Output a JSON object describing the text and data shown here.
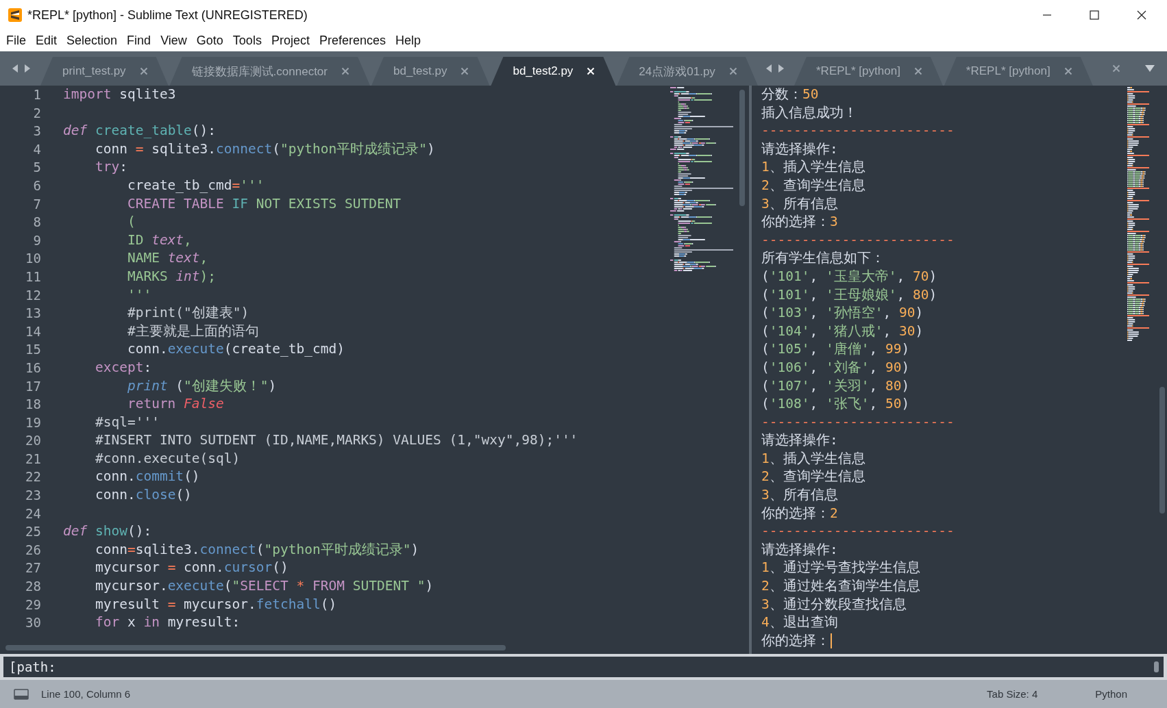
{
  "window": {
    "title": "*REPL* [python] - Sublime Text (UNREGISTERED)"
  },
  "menu": [
    "File",
    "Edit",
    "Selection",
    "Find",
    "View",
    "Goto",
    "Tools",
    "Project",
    "Preferences",
    "Help"
  ],
  "left_tabs": [
    {
      "label": "print_test.py",
      "selected": false
    },
    {
      "label": "链接数据库测试.connector",
      "selected": false
    },
    {
      "label": "bd_test.py",
      "selected": false
    },
    {
      "label": "bd_test2.py",
      "selected": true
    },
    {
      "label": "24点游戏01.py",
      "selected": false
    }
  ],
  "right_tabs": [
    {
      "label": "*REPL* [python]",
      "selected": false
    },
    {
      "label": "*REPL* [python]",
      "selected": false
    }
  ],
  "editor": {
    "lines": [
      {
        "number": "1",
        "tokens": [
          {
            "kind": "keyword",
            "text": "import"
          },
          {
            "kind": "plain",
            "text": " sqlite3"
          }
        ]
      },
      {
        "number": "2"
      },
      {
        "number": "3",
        "tokens": [
          {
            "kind": "storage",
            "text": "def"
          },
          {
            "kind": "entity",
            "text": " create_table"
          },
          {
            "kind": "plain",
            "text": "():"
          }
        ]
      },
      {
        "number": "4",
        "tokens": [
          {
            "kind": "plain",
            "text": "    conn "
          },
          {
            "kind": "operator",
            "text": "="
          },
          {
            "kind": "plain",
            "text": " sqlite3."
          },
          {
            "kind": "method",
            "text": "connect"
          },
          {
            "kind": "plain",
            "text": "("
          },
          {
            "kind": "string",
            "text": "\"python平时成绩记录\""
          },
          {
            "kind": "plain",
            "text": ")"
          }
        ]
      },
      {
        "number": "5",
        "tokens": [
          {
            "kind": "keyword",
            "text": "    try"
          },
          {
            "kind": "plain",
            "text": ":"
          }
        ]
      },
      {
        "number": "6",
        "tokens": [
          {
            "kind": "plain",
            "text": "        create_tb_cmd"
          },
          {
            "kind": "operator",
            "text": "="
          },
          {
            "kind": "string",
            "text": "'''"
          }
        ]
      },
      {
        "number": "7",
        "tokens": [
          {
            "kind": "keyword",
            "text": "        CREATE TABLE"
          },
          {
            "kind": "control",
            "text": " IF"
          },
          {
            "kind": "string",
            "text": " NOT EXISTS SUTDENT"
          }
        ]
      },
      {
        "number": "8",
        "tokens": [
          {
            "kind": "string",
            "text": "        ("
          }
        ]
      },
      {
        "number": "9",
        "tokens": [
          {
            "kind": "string",
            "text": "        ID "
          },
          {
            "kind": "storage",
            "text": "text"
          },
          {
            "kind": "string",
            "text": ","
          }
        ]
      },
      {
        "number": "10",
        "tokens": [
          {
            "kind": "string",
            "text": "        NAME "
          },
          {
            "kind": "storage",
            "text": "text"
          },
          {
            "kind": "string",
            "text": ","
          }
        ]
      },
      {
        "number": "11",
        "tokens": [
          {
            "kind": "string",
            "text": "        MARKS "
          },
          {
            "kind": "storage",
            "text": "int"
          },
          {
            "kind": "string",
            "text": ");"
          }
        ]
      },
      {
        "number": "12",
        "tokens": [
          {
            "kind": "string",
            "text": "        '''"
          }
        ]
      },
      {
        "number": "13",
        "tokens": [
          {
            "kind": "comment",
            "text": "        #print(\"创建表\")"
          }
        ]
      },
      {
        "number": "14",
        "tokens": [
          {
            "kind": "comment",
            "text": "        #主要就是上面的语句"
          }
        ]
      },
      {
        "number": "15",
        "tokens": [
          {
            "kind": "plain",
            "text": "        conn."
          },
          {
            "kind": "method",
            "text": "execute"
          },
          {
            "kind": "plain",
            "text": "(create_tb_cmd)"
          }
        ]
      },
      {
        "number": "16",
        "tokens": [
          {
            "kind": "keyword",
            "text": "    except"
          },
          {
            "kind": "plain",
            "text": ":"
          }
        ]
      },
      {
        "number": "17",
        "tokens": [
          {
            "kind": "builtin",
            "text": "        print"
          },
          {
            "kind": "plain",
            "text": " ("
          },
          {
            "kind": "string",
            "text": "\"创建失败！\""
          },
          {
            "kind": "plain",
            "text": ")"
          }
        ]
      },
      {
        "number": "18",
        "tokens": [
          {
            "kind": "keyword",
            "text": "        return"
          },
          {
            "kind": "constant",
            "text": " False"
          }
        ]
      },
      {
        "number": "19",
        "tokens": [
          {
            "kind": "comment",
            "text": "    #sql='''"
          }
        ]
      },
      {
        "number": "20",
        "tokens": [
          {
            "kind": "comment",
            "text": "    #INSERT INTO SUTDENT (ID,NAME,MARKS) VALUES (1,\"wxy\",98);'''"
          }
        ]
      },
      {
        "number": "21",
        "tokens": [
          {
            "kind": "comment",
            "text": "    #conn.execute(sql)"
          }
        ]
      },
      {
        "number": "22",
        "tokens": [
          {
            "kind": "plain",
            "text": "    conn."
          },
          {
            "kind": "method",
            "text": "commit"
          },
          {
            "kind": "plain",
            "text": "()"
          }
        ]
      },
      {
        "number": "23",
        "tokens": [
          {
            "kind": "plain",
            "text": "    conn."
          },
          {
            "kind": "method",
            "text": "close"
          },
          {
            "kind": "plain",
            "text": "()"
          }
        ]
      },
      {
        "number": "24"
      },
      {
        "number": "25",
        "tokens": [
          {
            "kind": "storage",
            "text": "def"
          },
          {
            "kind": "entity",
            "text": " show"
          },
          {
            "kind": "plain",
            "text": "():"
          }
        ]
      },
      {
        "number": "26",
        "tokens": [
          {
            "kind": "plain",
            "text": "    conn"
          },
          {
            "kind": "operator",
            "text": "="
          },
          {
            "kind": "plain",
            "text": "sqlite3."
          },
          {
            "kind": "method",
            "text": "connect"
          },
          {
            "kind": "plain",
            "text": "("
          },
          {
            "kind": "string",
            "text": "\"python平时成绩记录\""
          },
          {
            "kind": "plain",
            "text": ")"
          }
        ]
      },
      {
        "number": "27",
        "tokens": [
          {
            "kind": "plain",
            "text": "    mycursor "
          },
          {
            "kind": "operator",
            "text": "="
          },
          {
            "kind": "plain",
            "text": " conn."
          },
          {
            "kind": "method",
            "text": "cursor"
          },
          {
            "kind": "plain",
            "text": "()"
          }
        ]
      },
      {
        "number": "28",
        "tokens": [
          {
            "kind": "plain",
            "text": "    mycursor."
          },
          {
            "kind": "method",
            "text": "execute"
          },
          {
            "kind": "plain",
            "text": "("
          },
          {
            "kind": "string",
            "text": "\""
          },
          {
            "kind": "keyword",
            "text": "SELECT"
          },
          {
            "kind": "operator",
            "text": " * "
          },
          {
            "kind": "keyword",
            "text": "FROM"
          },
          {
            "kind": "string",
            "text": " SUTDENT \""
          },
          {
            "kind": "plain",
            "text": ")"
          }
        ]
      },
      {
        "number": "29",
        "tokens": [
          {
            "kind": "plain",
            "text": "    myresult "
          },
          {
            "kind": "operator",
            "text": "="
          },
          {
            "kind": "plain",
            "text": " mycursor."
          },
          {
            "kind": "method",
            "text": "fetchall"
          },
          {
            "kind": "plain",
            "text": "()"
          }
        ]
      },
      {
        "number": "30",
        "tokens": [
          {
            "kind": "keyword",
            "text": "    for"
          },
          {
            "kind": "plain",
            "text": " x "
          },
          {
            "kind": "keyword",
            "text": "in"
          },
          {
            "kind": "plain",
            "text": " myresult:"
          }
        ]
      }
    ]
  },
  "repl": {
    "cursor_at_end": true,
    "lines": [
      {
        "tokens": [
          {
            "kind": "plain",
            "text": "分数："
          },
          {
            "kind": "number",
            "text": "50"
          }
        ]
      },
      {
        "tokens": [
          {
            "kind": "plain",
            "text": "插入信息成功！"
          }
        ]
      },
      {
        "tokens": [
          {
            "kind": "separator",
            "text": "------------------------"
          }
        ]
      },
      {
        "tokens": [
          {
            "kind": "plain",
            "text": "请选择操作:"
          }
        ]
      },
      {
        "tokens": [
          {
            "kind": "number",
            "text": "1"
          },
          {
            "kind": "plain",
            "text": "、插入学生信息"
          }
        ]
      },
      {
        "tokens": [
          {
            "kind": "number",
            "text": "2"
          },
          {
            "kind": "plain",
            "text": "、查询学生信息"
          }
        ]
      },
      {
        "tokens": [
          {
            "kind": "number",
            "text": "3"
          },
          {
            "kind": "plain",
            "text": "、所有信息"
          }
        ]
      },
      {
        "tokens": [
          {
            "kind": "plain",
            "text": "你的选择："
          },
          {
            "kind": "number",
            "text": "3"
          }
        ]
      },
      {
        "tokens": [
          {
            "kind": "separator",
            "text": "------------------------"
          }
        ]
      },
      {
        "tokens": [
          {
            "kind": "plain",
            "text": "所有学生信息如下："
          }
        ]
      },
      {
        "tokens": [
          {
            "kind": "plain",
            "text": "("
          },
          {
            "kind": "string",
            "text": "'101'"
          },
          {
            "kind": "plain",
            "text": ", "
          },
          {
            "kind": "string",
            "text": "'玉皇大帝'"
          },
          {
            "kind": "plain",
            "text": ", "
          },
          {
            "kind": "number",
            "text": "70"
          },
          {
            "kind": "plain",
            "text": ")"
          }
        ]
      },
      {
        "tokens": [
          {
            "kind": "plain",
            "text": "("
          },
          {
            "kind": "string",
            "text": "'101'"
          },
          {
            "kind": "plain",
            "text": ", "
          },
          {
            "kind": "string",
            "text": "'王母娘娘'"
          },
          {
            "kind": "plain",
            "text": ", "
          },
          {
            "kind": "number",
            "text": "80"
          },
          {
            "kind": "plain",
            "text": ")"
          }
        ]
      },
      {
        "tokens": [
          {
            "kind": "plain",
            "text": "("
          },
          {
            "kind": "string",
            "text": "'103'"
          },
          {
            "kind": "plain",
            "text": ", "
          },
          {
            "kind": "string",
            "text": "'孙悟空'"
          },
          {
            "kind": "plain",
            "text": ", "
          },
          {
            "kind": "number",
            "text": "90"
          },
          {
            "kind": "plain",
            "text": ")"
          }
        ]
      },
      {
        "tokens": [
          {
            "kind": "plain",
            "text": "("
          },
          {
            "kind": "string",
            "text": "'104'"
          },
          {
            "kind": "plain",
            "text": ", "
          },
          {
            "kind": "string",
            "text": "'猪八戒'"
          },
          {
            "kind": "plain",
            "text": ", "
          },
          {
            "kind": "number",
            "text": "30"
          },
          {
            "kind": "plain",
            "text": ")"
          }
        ]
      },
      {
        "tokens": [
          {
            "kind": "plain",
            "text": "("
          },
          {
            "kind": "string",
            "text": "'105'"
          },
          {
            "kind": "plain",
            "text": ", "
          },
          {
            "kind": "string",
            "text": "'唐僧'"
          },
          {
            "kind": "plain",
            "text": ", "
          },
          {
            "kind": "number",
            "text": "99"
          },
          {
            "kind": "plain",
            "text": ")"
          }
        ]
      },
      {
        "tokens": [
          {
            "kind": "plain",
            "text": "("
          },
          {
            "kind": "string",
            "text": "'106'"
          },
          {
            "kind": "plain",
            "text": ", "
          },
          {
            "kind": "string",
            "text": "'刘备'"
          },
          {
            "kind": "plain",
            "text": ", "
          },
          {
            "kind": "number",
            "text": "90"
          },
          {
            "kind": "plain",
            "text": ")"
          }
        ]
      },
      {
        "tokens": [
          {
            "kind": "plain",
            "text": "("
          },
          {
            "kind": "string",
            "text": "'107'"
          },
          {
            "kind": "plain",
            "text": ", "
          },
          {
            "kind": "string",
            "text": "'关羽'"
          },
          {
            "kind": "plain",
            "text": ", "
          },
          {
            "kind": "number",
            "text": "80"
          },
          {
            "kind": "plain",
            "text": ")"
          }
        ]
      },
      {
        "tokens": [
          {
            "kind": "plain",
            "text": "("
          },
          {
            "kind": "string",
            "text": "'108'"
          },
          {
            "kind": "plain",
            "text": ", "
          },
          {
            "kind": "string",
            "text": "'张飞'"
          },
          {
            "kind": "plain",
            "text": ", "
          },
          {
            "kind": "number",
            "text": "50"
          },
          {
            "kind": "plain",
            "text": ")"
          }
        ]
      },
      {
        "tokens": [
          {
            "kind": "separator",
            "text": "------------------------"
          }
        ]
      },
      {
        "tokens": [
          {
            "kind": "plain",
            "text": "请选择操作:"
          }
        ]
      },
      {
        "tokens": [
          {
            "kind": "number",
            "text": "1"
          },
          {
            "kind": "plain",
            "text": "、插入学生信息"
          }
        ]
      },
      {
        "tokens": [
          {
            "kind": "number",
            "text": "2"
          },
          {
            "kind": "plain",
            "text": "、查询学生信息"
          }
        ]
      },
      {
        "tokens": [
          {
            "kind": "number",
            "text": "3"
          },
          {
            "kind": "plain",
            "text": "、所有信息"
          }
        ]
      },
      {
        "tokens": [
          {
            "kind": "plain",
            "text": "你的选择："
          },
          {
            "kind": "number",
            "text": "2"
          }
        ]
      },
      {
        "tokens": [
          {
            "kind": "separator",
            "text": "------------------------"
          }
        ]
      },
      {
        "tokens": [
          {
            "kind": "plain",
            "text": "请选择操作:"
          }
        ]
      },
      {
        "tokens": [
          {
            "kind": "number",
            "text": "1"
          },
          {
            "kind": "plain",
            "text": "、通过学号查找学生信息"
          }
        ]
      },
      {
        "tokens": [
          {
            "kind": "number",
            "text": "2"
          },
          {
            "kind": "plain",
            "text": "、通过姓名查询学生信息"
          }
        ]
      },
      {
        "tokens": [
          {
            "kind": "number",
            "text": "3"
          },
          {
            "kind": "plain",
            "text": "、通过分数段查找信息"
          }
        ]
      },
      {
        "tokens": [
          {
            "kind": "number",
            "text": "4"
          },
          {
            "kind": "plain",
            "text": "、退出查询"
          }
        ]
      },
      {
        "tokens": [
          {
            "kind": "plain",
            "text": "你的选择："
          }
        ]
      }
    ]
  },
  "input_panel": {
    "value": "[path:"
  },
  "status_bar": {
    "position": "Line 100, Column 6",
    "tab_size": "Tab Size: 4",
    "syntax": "Python"
  }
}
